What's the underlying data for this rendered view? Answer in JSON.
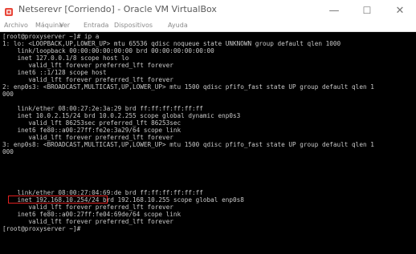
{
  "window": {
    "title": "Netserevr [Corriendo] - Oracle VM VirtualBox",
    "icon": "virtualbox-icon",
    "controls": {
      "minimize": "—",
      "maximize": "☐",
      "close": "✕"
    }
  },
  "menu": {
    "items": [
      "Archivo",
      "Máquina",
      "Ver",
      "Entrada",
      "Dispositivos",
      "Ayuda"
    ]
  },
  "terminal": {
    "lines": [
      "[root@proxyserver ~]# ip a",
      "1: lo: <LOOPBACK,UP,LOWER_UP> mtu 65536 qdisc noqueue state UNKNOWN group default qlen 1000",
      "    link/loopback 00:00:00:00:00:00 brd 00:00:00:00:00:00",
      "    inet 127.0.0.1/8 scope host lo",
      "       valid_lft forever preferred_lft forever",
      "    inet6 ::1/128 scope host",
      "       valid_lft forever preferred_lft forever",
      "2: enp0s3: <BROADCAST,MULTICAST,UP,LOWER_UP> mtu 1500 qdisc pfifo_fast state UP group default qlen 1",
      "000",
      "    link/ether 08:00:27:2e:3a:29 brd ff:ff:ff:ff:ff:ff",
      "    inet 10.0.2.15/24 brd 10.0.2.255 scope global dynamic enp0s3",
      "       valid_lft 86253sec preferred_lft 86253sec",
      "    inet6 fe80::a00:27ff:fe2e:3a29/64 scope link",
      "       valid_lft forever preferred_lft forever",
      "3: enp0s8: <BROADCAST,MULTICAST,UP,LOWER_UP> mtu 1500 qdisc pfifo_fast state UP group default qlen 1",
      "000",
      "    link/ether 08:00:27:04:69:de brd ff:ff:ff:ff:ff:ff",
      "    inet 192.168.10.254/24 brd 192.168.10.255 scope global enp0s8",
      "       valid_lft forever preferred_lft forever",
      "    inet6 fe80::a00:27ff:fe04:69de/64 scope link",
      "       valid_lft forever preferred_lft forever",
      "[root@proxyserver ~]#"
    ],
    "highlighted_text": "inet 192.168.10.254/24"
  },
  "colors": {
    "terminal_text": "#c8c8c8",
    "terminal_background": "#000000",
    "highlight_border": "#e02020",
    "icon_accent": "#e8473a"
  }
}
